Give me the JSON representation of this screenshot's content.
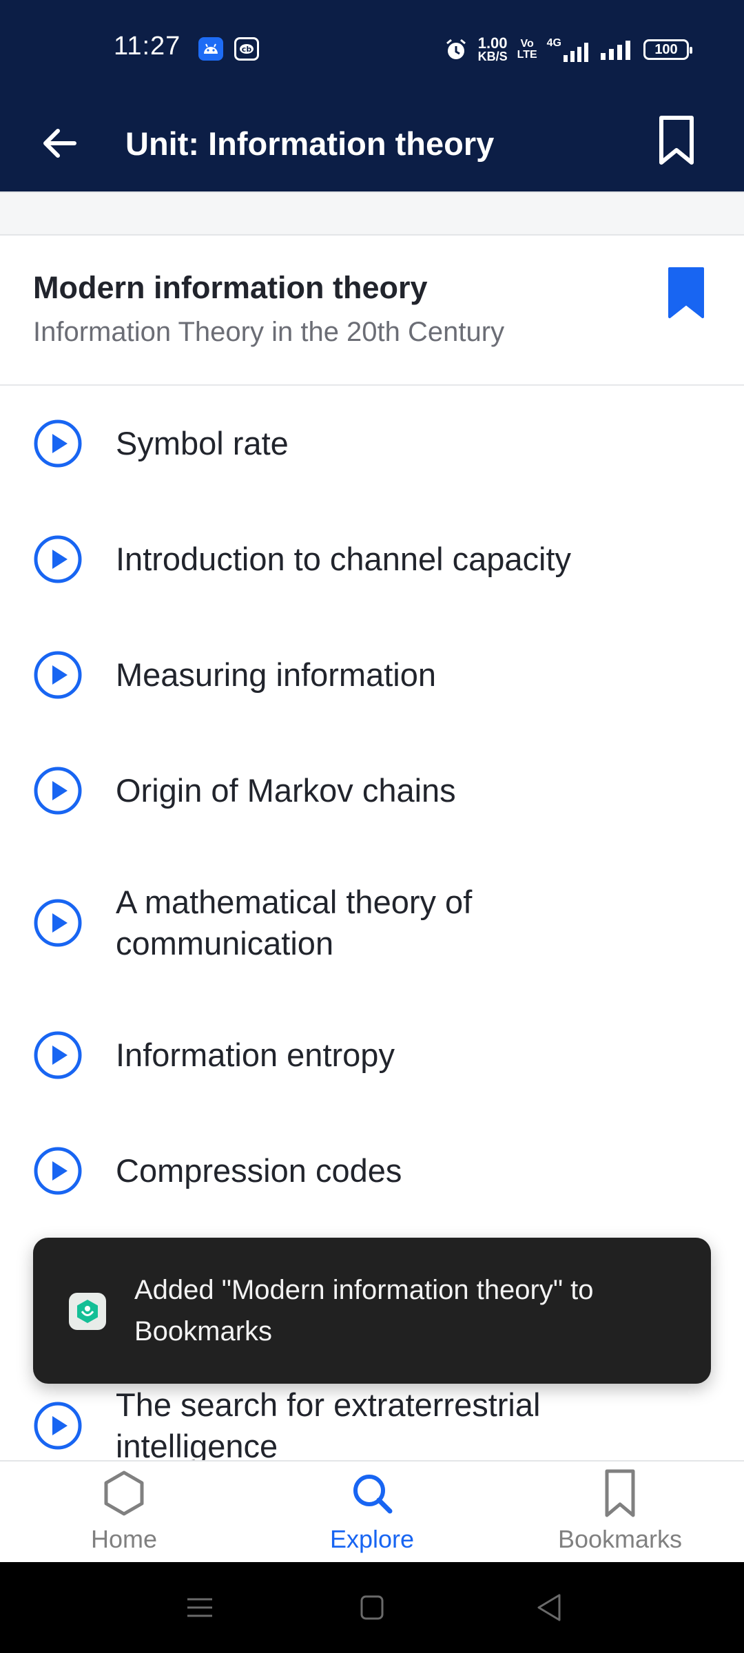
{
  "status_bar": {
    "time": "11:27",
    "net_speed_value": "1.00",
    "net_speed_unit": "KB/S",
    "volte_top": "Vo",
    "volte_bottom": "LTE",
    "network_type": "4G",
    "battery": "100"
  },
  "app_bar": {
    "title": "Unit: Information theory",
    "back_icon": "arrow-left-icon",
    "bookmark_icon": "bookmark-outline-icon"
  },
  "lesson": {
    "title": "Modern information theory",
    "subtitle": "Information Theory in the 20th Century",
    "bookmarked": true
  },
  "videos": [
    {
      "label": "Symbol rate"
    },
    {
      "label": "Introduction to channel capacity"
    },
    {
      "label": "Measuring information"
    },
    {
      "label": "Origin of Markov chains"
    },
    {
      "label": "A mathematical theory of communication"
    },
    {
      "label": "Information entropy"
    },
    {
      "label": "Compression codes"
    },
    {
      "label": "The search for extraterrestrial intelligence"
    }
  ],
  "toast": {
    "message": "Added \"Modern information theory\" to Bookmarks"
  },
  "bottom_nav": {
    "items": [
      {
        "label": "Home",
        "icon": "hexagon-home-icon",
        "active": false
      },
      {
        "label": "Explore",
        "icon": "search-icon",
        "active": true
      },
      {
        "label": "Bookmarks",
        "icon": "bookmark-icon",
        "active": false
      }
    ]
  },
  "colors": {
    "header_bg": "#0c1e46",
    "accent": "#1865f2",
    "text_primary": "#21242c",
    "text_secondary": "#6b6d75",
    "toast_bg": "#212121",
    "nav_inactive": "#808080"
  }
}
